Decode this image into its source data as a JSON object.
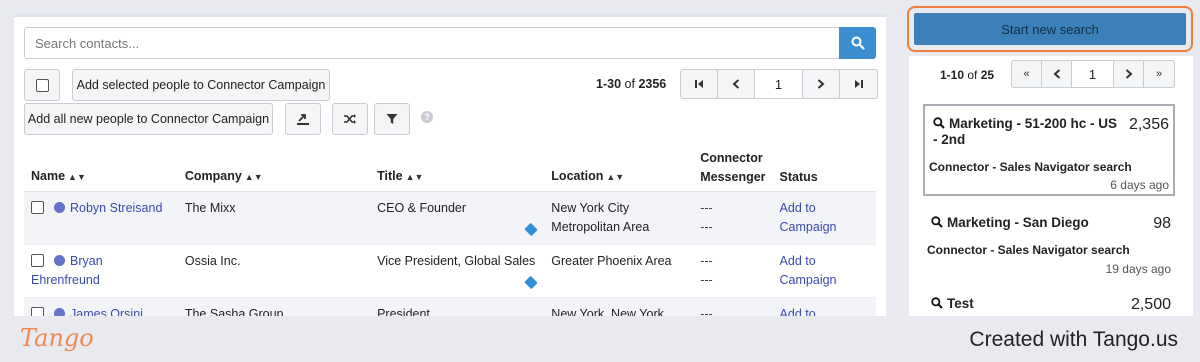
{
  "search": {
    "placeholder": "Search contacts..."
  },
  "toolbar": {
    "add_selected_label": "Add selected people to Connector Campaign",
    "add_all_label": "Add all new people to Connector Campaign",
    "export_icon": "export-icon",
    "shuffle_icon": "shuffle-icon",
    "filter_icon": "filter-icon",
    "help_icon_glyph": "?"
  },
  "pagination": {
    "range": "1-30",
    "of_word": "of",
    "total": "2356",
    "page": "1"
  },
  "table": {
    "headers": {
      "name": "Name",
      "company": "Company",
      "title": "Title",
      "location": "Location",
      "messenger_line1": "Connector",
      "messenger_line2": "Messenger",
      "status": "Status"
    },
    "rows": [
      {
        "name": "Robyn Streisand",
        "company": "The Mixx",
        "title": "CEO & Founder",
        "location": "New York City Metropolitan Area",
        "messenger_1": "---",
        "messenger_2": "---",
        "status": "Add to Campaign"
      },
      {
        "name": "Bryan Ehrenfreund",
        "company": "Ossia Inc.",
        "title": "Vice President, Global Sales",
        "location": "Greater Phoenix Area",
        "messenger_1": "---",
        "messenger_2": "---",
        "status": "Add to Campaign"
      },
      {
        "name": "James Orsini",
        "company": "The Sasha Group",
        "title": "President",
        "location": "New York, New York",
        "messenger_1": "---",
        "messenger_2": "---",
        "status": "Add to Campaign"
      }
    ]
  },
  "side": {
    "start_label": "Start new search",
    "range": "1-10",
    "of_word": "of",
    "total": "25",
    "page": "1",
    "first_glyph": "«",
    "last_glyph": "»",
    "searches": [
      {
        "title": "Marketing - 51-200 hc - US - 2nd",
        "count": "2,356",
        "type": "Connector - Sales Navigator search",
        "date": "6 days ago"
      },
      {
        "title": "Marketing - San Diego",
        "count": "98",
        "type": "Connector - Sales Navigator search",
        "date": "19 days ago"
      },
      {
        "title": "Test",
        "count": "2,500",
        "type": "",
        "date": ""
      }
    ]
  },
  "footer": {
    "logo": "Tango",
    "created": "Created with Tango.us"
  },
  "colors": {
    "primary": "#3b8fd0",
    "start_button": "#3b80b8",
    "highlight": "#f07f3c",
    "link": "#3a4bb0",
    "brand": "#f08a52"
  }
}
